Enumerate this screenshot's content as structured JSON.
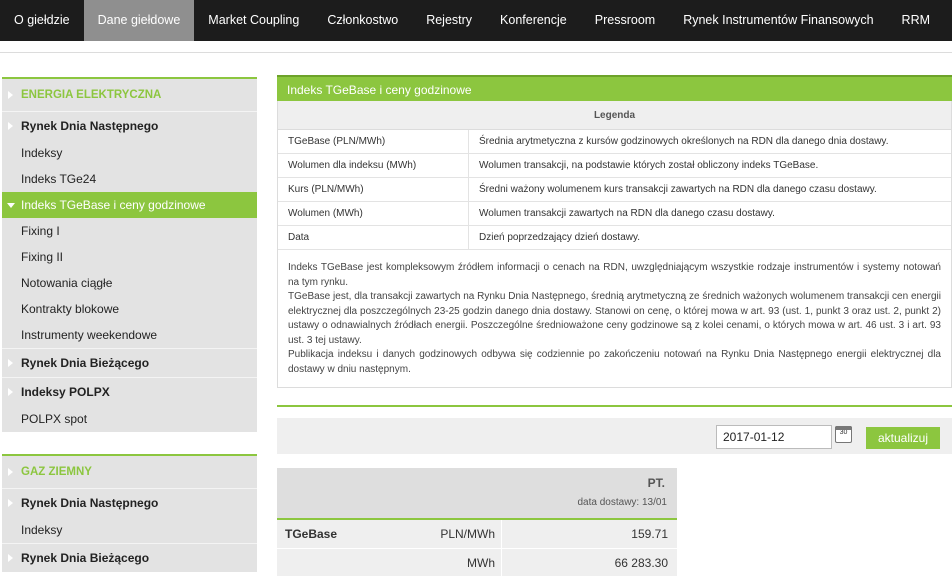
{
  "nav": {
    "items": [
      "O giełdzie",
      "Dane giełdowe",
      "Market Coupling",
      "Członkostwo",
      "Rejestry",
      "Konferencje",
      "Pressroom",
      "Rynek Instrumentów Finansowych",
      "RRM"
    ],
    "active_index": 1
  },
  "sidebar": {
    "energy": {
      "header": "ENERGIA ELEKTRYCZNA",
      "rdn": "Rynek Dnia Następnego",
      "indeksy": "Indeksy",
      "tge24": "Indeks TGe24",
      "tgebase": "Indeks TGeBase i ceny godzinowe",
      "fixing1": "Fixing I",
      "fixing2": "Fixing II",
      "notowania": "Notowania ciągłe",
      "kontrakty": "Kontrakty blokowe",
      "weekendowe": "Instrumenty weekendowe",
      "rdb": "Rynek Dnia Bieżącego",
      "polpx": "Indeksy POLPX",
      "polpx_spot": "POLPX spot"
    },
    "gas": {
      "header": "GAZ ZIEMNY",
      "rdn": "Rynek Dnia Następnego",
      "indeksy": "Indeksy",
      "rdb": "Rynek Dnia Bieżącego"
    }
  },
  "main": {
    "title": "Indeks TGeBase i ceny godzinowe",
    "legend_title": "Legenda",
    "legend": [
      {
        "term": "TGeBase (PLN/MWh)",
        "desc": "Średnia arytmetyczna z kursów godzinowych określonych na RDN dla danego dnia dostawy."
      },
      {
        "term": "Wolumen dla indeksu (MWh)",
        "desc": "Wolumen transakcji, na podstawie których został obliczony indeks TGeBase."
      },
      {
        "term": "Kurs (PLN/MWh)",
        "desc": "Średni ważony wolumenem kurs transakcji zawartych na RDN dla danego czasu dostawy."
      },
      {
        "term": "Wolumen (MWh)",
        "desc": "Wolumen transakcji zawartych na RDN dla danego czasu dostawy."
      },
      {
        "term": "Data",
        "desc": "Dzień poprzedzający dzień dostawy."
      }
    ],
    "para1": "Indeks TGeBase jest kompleksowym źródłem informacji o cenach na RDN, uwzględniającym wszystkie rodzaje instrumentów i systemy notowań na tym rynku.",
    "para2": "TGeBase jest, dla transakcji zawartych na Rynku Dnia Następnego, średnią arytmetyczną ze średnich ważonych wolumenem transakcji cen energii elektrycznej dla poszczególnych 23-25 godzin danego dnia dostawy. Stanowi on cenę, o której mowa w art. 93 (ust. 1, punkt 3 oraz ust. 2, punkt 2) ustawy o odnawialnych źródłach energii. Poszczególne średnioważone ceny godzinowe są z kolei cenami, o których mowa w art. 46 ust. 3 i art. 93 ust. 3 tej ustawy.",
    "para3": "Publikacja indeksu i danych godzinowych odbywa się codziennie po zakończeniu notowań na Rynku Dnia Następnego energii elektrycznej dla dostawy w dniu następnym."
  },
  "filter": {
    "date": "2017-01-12",
    "calendar_day": "30",
    "update_label": "aktualizuj"
  },
  "table": {
    "day": "PT.",
    "delivery": "data dostawy: 13/01",
    "rows": [
      {
        "label": "TGeBase",
        "unit": "PLN/MWh",
        "value": "159.71"
      },
      {
        "label": "",
        "unit": "MWh",
        "value": "66 283.30"
      }
    ]
  },
  "colors": {
    "accent": "#8cc63f",
    "nav_bg": "#1c1c1c",
    "nav_active": "#8f8f8f"
  }
}
